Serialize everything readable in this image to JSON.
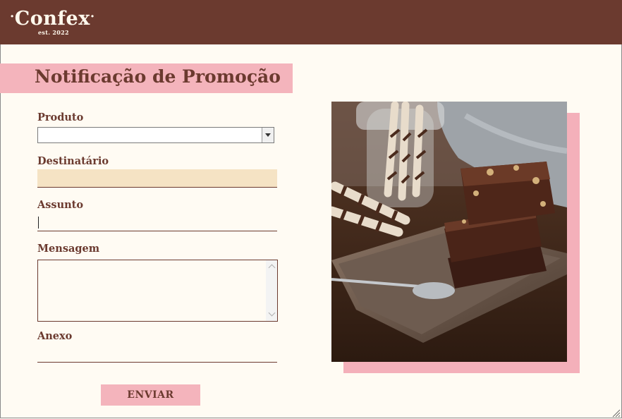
{
  "brand": {
    "name": "Confex",
    "tagline": "est. 2022",
    "dot": "·"
  },
  "page": {
    "title": "Notificação de Promoção"
  },
  "form": {
    "produto_label": "Produto",
    "produto_value": "",
    "destinatario_label": "Destinatário",
    "destinatario_value": "",
    "assunto_label": "Assunto",
    "assunto_value": "",
    "mensagem_label": "Mensagem",
    "mensagem_value": "",
    "anexo_label": "Anexo",
    "send_label": "ENVIAR"
  },
  "colors": {
    "brand_brown": "#6b3a2f",
    "accent_pink": "#f4b4bc",
    "field_fill": "#f5e3c4",
    "background": "#fffbf3"
  },
  "icons": [
    "dropdown-arrow-icon",
    "scroll-up-icon",
    "scroll-down-icon",
    "resize-grip-icon"
  ]
}
